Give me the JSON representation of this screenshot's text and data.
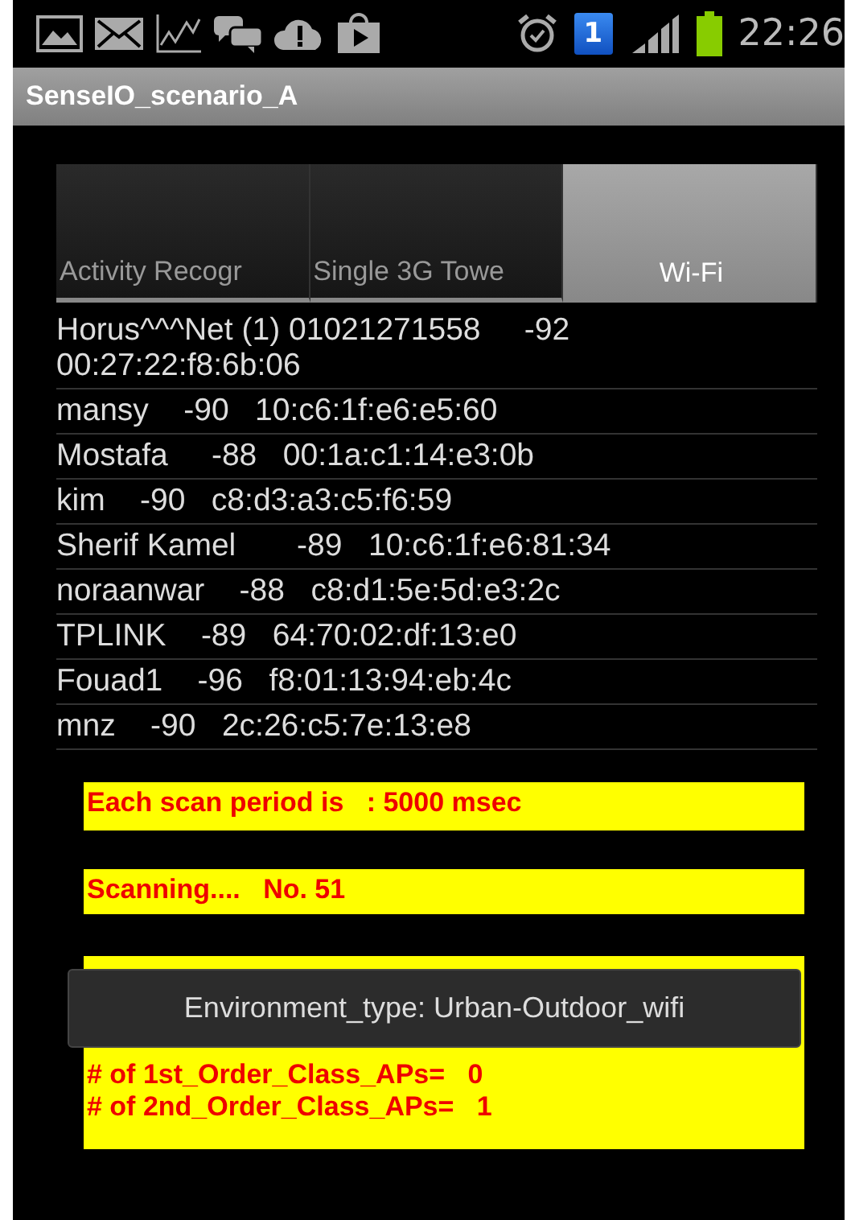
{
  "status_bar": {
    "sim_badge": "1",
    "time": "22:26"
  },
  "window": {
    "title": "SenseIO_scenario_A"
  },
  "tabs": [
    {
      "label": "Activity Recogr",
      "selected": false
    },
    {
      "label": "Single 3G Towe",
      "selected": false
    },
    {
      "label": "Wi-Fi",
      "selected": true
    }
  ],
  "networks": [
    {
      "text": "Horus^^^Net (1) 01021271558     -92 00:27:22:f8:6b:06"
    },
    {
      "text": "mansy    -90   10:c6:1f:e6:e5:60"
    },
    {
      "text": "Mostafa     -88   00:1a:c1:14:e3:0b"
    },
    {
      "text": "kim    -90   c8:d3:a3:c5:f6:59"
    },
    {
      "text": "Sherif Kamel       -89   10:c6:1f:e6:81:34"
    },
    {
      "text": "noraanwar    -88   c8:d1:5e:5d:e3:2c"
    },
    {
      "text": "TPLINK    -89   64:70:02:df:13:e0"
    },
    {
      "text": "Fouad1    -96   f8:01:13:94:eb:4c"
    },
    {
      "text": "mnz    -90   2c:26:c5:7e:13:e8"
    }
  ],
  "info_boxes": [
    {
      "lines": [
        "Each scan period is   : 5000 msec"
      ]
    },
    {
      "lines": [
        "Scanning....   No. 51"
      ]
    },
    {
      "lines": [
        "# of 1st_Order_Class_APs=   0",
        "# of 2nd_Order_Class_APs=   1"
      ]
    }
  ],
  "toast": {
    "text": "Environment_type:  Urban-Outdoor_wifi"
  }
}
